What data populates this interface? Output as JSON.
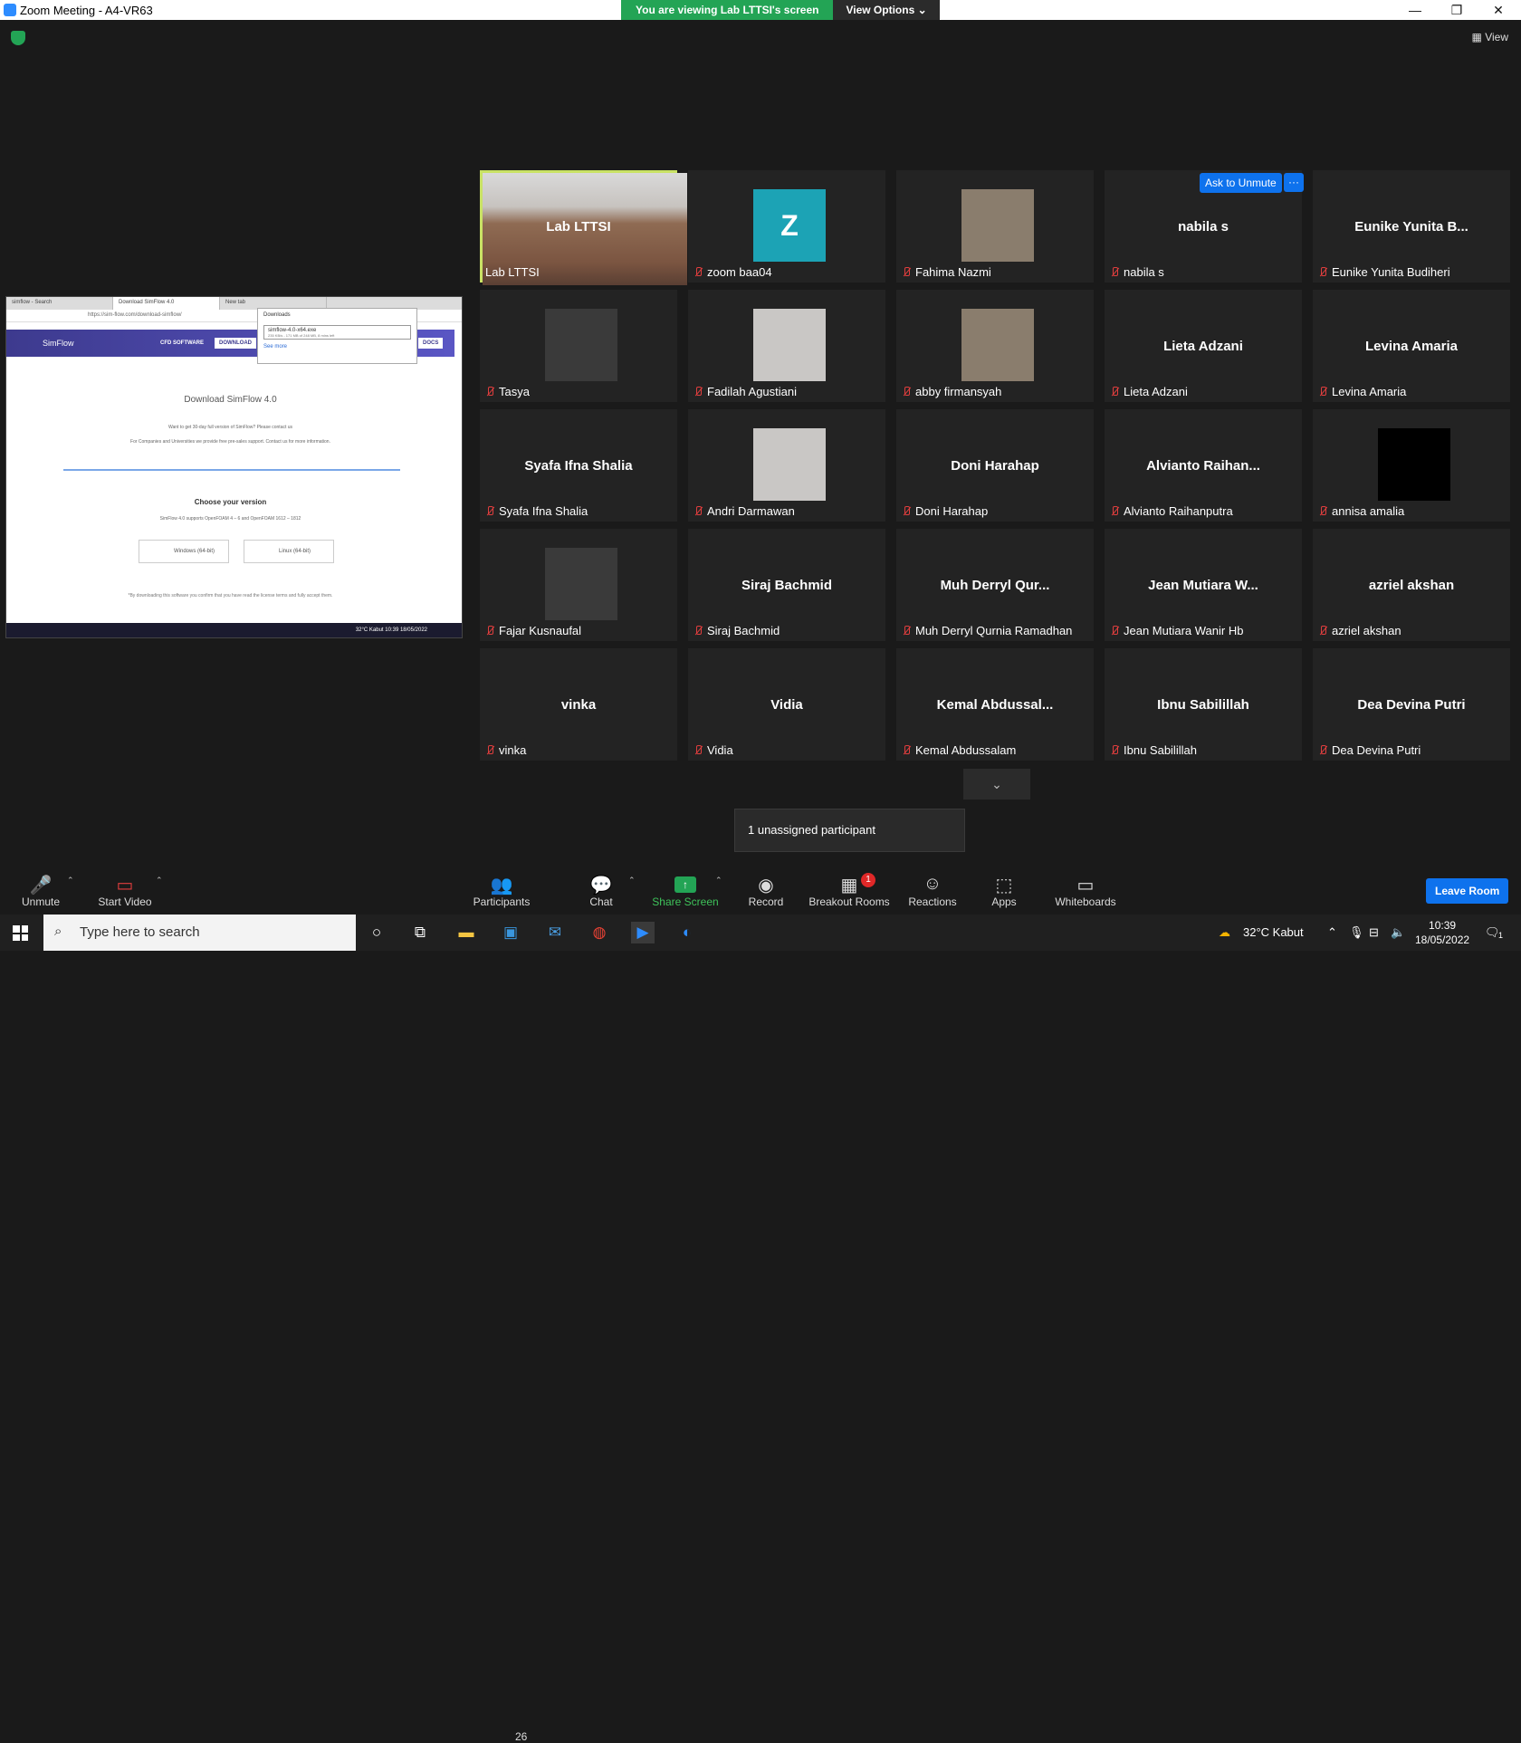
{
  "window": {
    "title": "Zoom Meeting - A4-VR63"
  },
  "share_bar": {
    "message": "You are viewing Lab LTTSI's screen",
    "view_options": "View Options ⌄"
  },
  "view_button": "View",
  "shared_screen": {
    "tabs": [
      "simflow - Search",
      "Download SimFlow 4.0",
      "New tab"
    ],
    "url": "https://sim-flow.com/download-simflow/",
    "logo": "SimFlow",
    "nav_cfd": "CFD SOFTWARE",
    "nav_download": "DOWNLOAD",
    "nav_docs": "DOCS",
    "downloads_title": "Downloads",
    "download_file": "simflow-4.0-x64.exe",
    "download_progress": "235 KB/s - 171 MB of 248 MB, 8 mins left",
    "see_more": "See more",
    "heading": "Download SimFlow 4.0",
    "line1": "Want to get 30-day full version of SimFlow? Please contact us",
    "line2": "For Companies and Universities we provide free pre-sales support. Contact us for more information.",
    "choose": "Choose your version",
    "supports": "SimFlow 4.0 supports OpenFOAM 4 – 6 and OpenFOAM 1612 – 1812",
    "windows_btn": "Windows (64-bit)",
    "linux_btn": "Linux (64-bit)",
    "disclaimer": "*By downloading this software you confirm that you have read the license terms and fully accept them.",
    "taskbar_weather": "32°C Kabut",
    "taskbar_time": "10:39",
    "taskbar_date": "18/05/2022"
  },
  "tiles": [
    {
      "name": "Lab LTTSI",
      "label": "Lab LTTSI",
      "kind": "camera"
    },
    {
      "name": "",
      "label": "zoom baa04",
      "kind": "avatar-z",
      "initial": "Z"
    },
    {
      "name": "",
      "label": "Fahima Nazmi",
      "kind": "photo"
    },
    {
      "name": "nabila s",
      "label": "nabila s",
      "kind": "text"
    },
    {
      "name": "Eunike Yunita B...",
      "label": "Eunike Yunita Budiheri",
      "kind": "text"
    },
    {
      "name": "",
      "label": "Tasya",
      "kind": "photo"
    },
    {
      "name": "",
      "label": "Fadilah Agustiani",
      "kind": "photo"
    },
    {
      "name": "",
      "label": "abby firmansyah",
      "kind": "photo"
    },
    {
      "name": "Lieta Adzani",
      "label": "Lieta Adzani",
      "kind": "text"
    },
    {
      "name": "Levina Amaria",
      "label": "Levina Amaria",
      "kind": "text"
    },
    {
      "name": "Syafa Ifna Shalia",
      "label": "Syafa Ifna Shalia",
      "kind": "text"
    },
    {
      "name": "",
      "label": "Andri Darmawan",
      "kind": "photo"
    },
    {
      "name": "Doni Harahap",
      "label": "Doni Harahap",
      "kind": "text"
    },
    {
      "name": "Alvianto  Raihan...",
      "label": "Alvianto Raihanputra",
      "kind": "text"
    },
    {
      "name": "",
      "label": "annisa amalia",
      "kind": "black"
    },
    {
      "name": "",
      "label": "Fajar Kusnaufal",
      "kind": "photo"
    },
    {
      "name": "Siraj Bachmid",
      "label": "Siraj Bachmid",
      "kind": "text"
    },
    {
      "name": "Muh Derryl Qur...",
      "label": "Muh Derryl Qurnia Ramadhan",
      "kind": "text"
    },
    {
      "name": "Jean Mutiara W...",
      "label": "Jean Mutiara Wanir Hb",
      "kind": "text"
    },
    {
      "name": "azriel akshan",
      "label": "azriel akshan",
      "kind": "text"
    },
    {
      "name": "vinka",
      "label": "vinka",
      "kind": "text"
    },
    {
      "name": "Vidia",
      "label": "Vidia",
      "kind": "text"
    },
    {
      "name": "Kemal  Abdussal...",
      "label": "Kemal Abdussalam",
      "kind": "text"
    },
    {
      "name": "Ibnu Sabilillah",
      "label": "Ibnu Sabilillah",
      "kind": "text"
    },
    {
      "name": "Dea Devina Putri",
      "label": "Dea Devina Putri",
      "kind": "text"
    }
  ],
  "ask_to_unmute": "Ask to Unmute",
  "more_dots": "···",
  "unassigned": "1 unassigned participant",
  "toolbar": {
    "unmute": "Unmute",
    "start_video": "Start Video",
    "participants": "Participants",
    "participants_count": "26",
    "chat": "Chat",
    "share_screen": "Share Screen",
    "record": "Record",
    "breakout_rooms": "Breakout Rooms",
    "breakout_badge": "1",
    "reactions": "Reactions",
    "apps": "Apps",
    "whiteboards": "Whiteboards",
    "leave": "Leave Room"
  },
  "taskbar": {
    "search_placeholder": "Type here to search",
    "weather": "32°C  Kabut",
    "time": "10:39",
    "date": "18/05/2022",
    "notification_count": "1"
  },
  "colors": {
    "active_speaker": "#c9e265",
    "zoom_blue": "#0e72ed",
    "share_green": "#23a455"
  }
}
